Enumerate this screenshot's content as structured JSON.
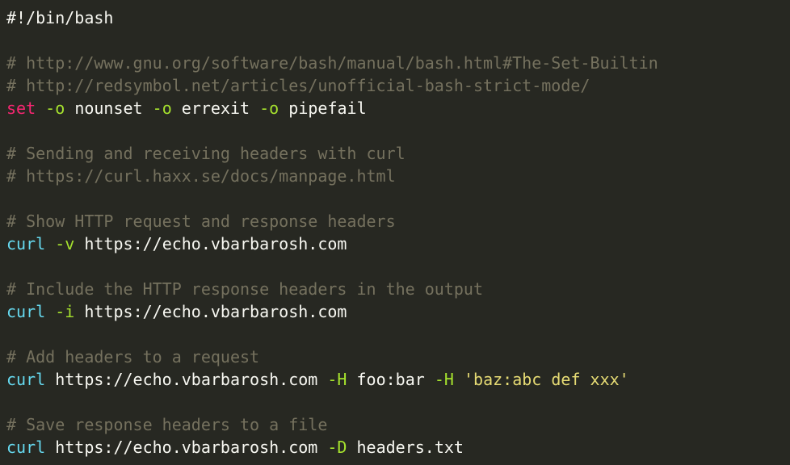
{
  "colors": {
    "background": "#272822",
    "text": "#f8f8f2",
    "comment": "#75715e",
    "keyword": "#f92672",
    "builtin": "#66d9ef",
    "flag": "#a6e22e",
    "string": "#e6db74"
  },
  "code": {
    "shebang": "#!/bin/bash",
    "c_set_builtin": "# http://www.gnu.org/software/bash/manual/bash.html#The-Set-Builtin",
    "c_strict_mode": "# http://redsymbol.net/articles/unofficial-bash-strict-mode/",
    "set_cmd": {
      "kw": "set",
      "f1": "-o",
      "a1": "nounset",
      "f2": "-o",
      "a2": "errexit",
      "f3": "-o",
      "a3": "pipefail"
    },
    "c_sending": "# Sending and receiving headers with curl",
    "c_manpage": "# https://curl.haxx.se/docs/manpage.html",
    "c_show": "# Show HTTP request and response headers",
    "curl_v": {
      "cmd": "curl",
      "flag": "-v",
      "url": "https://echo.vbarbarosh.com"
    },
    "c_include": "# Include the HTTP response headers in the output",
    "curl_i": {
      "cmd": "curl",
      "flag": "-i",
      "url": "https://echo.vbarbarosh.com"
    },
    "c_add": "# Add headers to a request",
    "curl_h": {
      "cmd": "curl",
      "url": "https://echo.vbarbarosh.com",
      "flag1": "-H",
      "arg1": "foo:bar",
      "flag2": "-H",
      "arg2": "'baz:abc def xxx'"
    },
    "c_save": "# Save response headers to a file",
    "curl_d": {
      "cmd": "curl",
      "url": "https://echo.vbarbarosh.com",
      "flag": "-D",
      "arg": "headers.txt"
    }
  }
}
